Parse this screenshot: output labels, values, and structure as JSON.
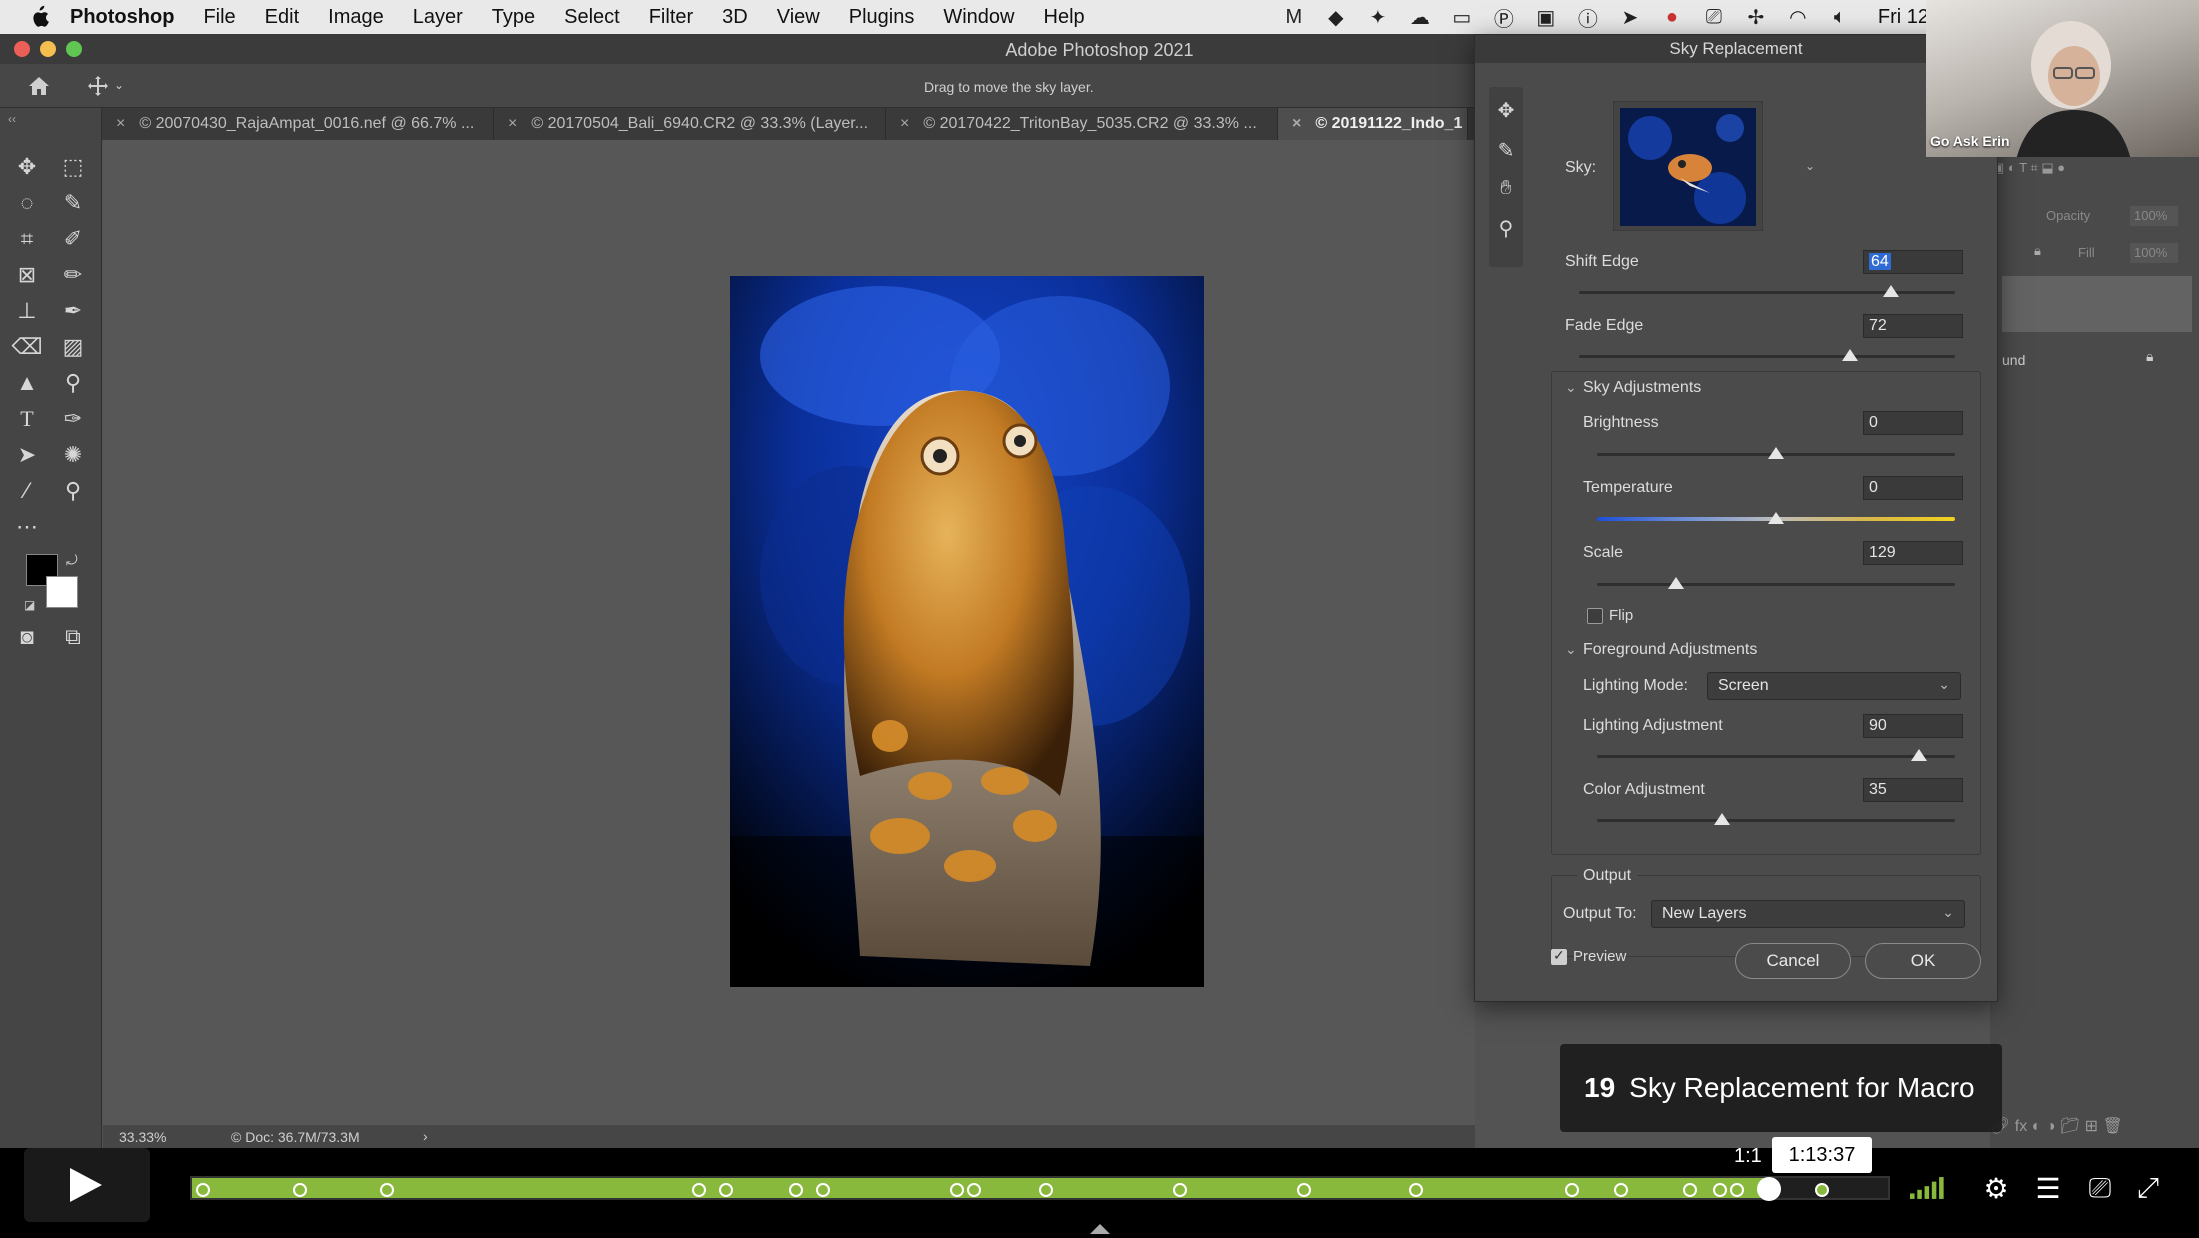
{
  "menubar": {
    "app": "Photoshop",
    "items": [
      "File",
      "Edit",
      "Image",
      "Layer",
      "Type",
      "Select",
      "Filter",
      "3D",
      "View",
      "Plugins",
      "Window",
      "Help"
    ],
    "clock": "Fri 12"
  },
  "window": {
    "title": "Adobe Photoshop 2021"
  },
  "options": {
    "hint": "Drag to move the sky layer."
  },
  "tabs": [
    "© 20070430_RajaAmpat_0016.nef @ 66.7% ...",
    "© 20170504_Bali_6940.CR2 @ 33.3% (Layer...",
    "© 20170422_TritonBay_5035.CR2 @ 33.3% ...",
    "© 20191122_Indo_1"
  ],
  "status": {
    "zoom": "33.33%",
    "doc": "Doc: 36.7M/73.3M",
    "arrow": "›"
  },
  "panel_partial": {
    "opacity": "Opacity",
    "opacity_val": "100%",
    "fill": "Fill",
    "fill_val": "100%",
    "layer": "und"
  },
  "dialog": {
    "title": "Sky Replacement",
    "sky_label": "Sky:",
    "shift_edge": {
      "label": "Shift Edge",
      "value": "64",
      "slider": 0.83
    },
    "fade_edge": {
      "label": "Fade Edge",
      "value": "72",
      "slider": 0.72
    },
    "sky_adjustments": {
      "heading": "Sky Adjustments",
      "brightness": {
        "label": "Brightness",
        "value": "0",
        "slider": 0.5
      },
      "temperature": {
        "label": "Temperature",
        "value": "0",
        "slider": 0.5
      },
      "scale": {
        "label": "Scale",
        "value": "129",
        "slider": 0.22
      },
      "flip": {
        "label": "Flip",
        "checked": false
      }
    },
    "foreground_adjustments": {
      "heading": "Foreground Adjustments",
      "lighting_mode_label": "Lighting Mode:",
      "lighting_mode": "Screen",
      "lighting_adjustment": {
        "label": "Lighting Adjustment",
        "value": "90",
        "slider": 0.9
      },
      "color_adjustment": {
        "label": "Color Adjustment",
        "value": "35",
        "slider": 0.35
      }
    },
    "output": {
      "heading": "Output",
      "output_to_label": "Output To:",
      "output_to": "New Layers"
    },
    "preview": {
      "label": "Preview",
      "checked": true
    },
    "cancel": "Cancel",
    "ok": "OK"
  },
  "webcam": {
    "label": "Go Ask Erin"
  },
  "player": {
    "chapter_number": "19",
    "chapter_title": "Sky Replacement for Macro",
    "time_hover": "1:13:37",
    "time_partial": "1:1",
    "progress": 0.93,
    "chapter_markers": [
      0.0,
      0.058,
      0.11,
      0.296,
      0.312,
      0.354,
      0.37,
      0.45,
      0.46,
      0.503,
      0.583,
      0.657,
      0.724,
      0.817,
      0.846,
      0.887,
      0.905,
      0.915,
      0.966
    ]
  },
  "colors": {
    "accent": "#89b93c",
    "selection": "#2f6bd4"
  }
}
